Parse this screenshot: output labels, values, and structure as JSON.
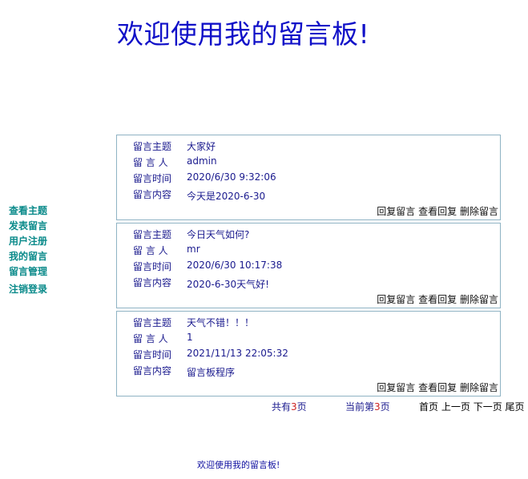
{
  "header": {
    "title": "欢迎使用我的留言板!"
  },
  "sidebar": {
    "items": [
      {
        "label": "查看主题"
      },
      {
        "label": "发表留言"
      },
      {
        "label": "用户注册"
      },
      {
        "label": "我的留言"
      },
      {
        "label": "留言管理"
      },
      {
        "label": "注销登录"
      }
    ]
  },
  "labels": {
    "subject": "留言主题",
    "author": "留 言 人",
    "time": "留言时间",
    "content": "留言内容"
  },
  "actions": {
    "reply": "回复留言",
    "view_replies": "查看回复",
    "delete": "删除留言"
  },
  "messages": [
    {
      "subject": "大家好",
      "author": "admin",
      "time": "2020/6/30 9:32:06",
      "content": "今天是2020-6-30"
    },
    {
      "subject": "今日天气如何?",
      "author": "mr",
      "time": "2020/6/30 10:17:38",
      "content": "2020-6-30天气好!"
    },
    {
      "subject": "天气不错！！！",
      "author": "1",
      "time": "2021/11/13 22:05:32",
      "content": "留言板程序"
    }
  ],
  "pager": {
    "total_prefix": "共有",
    "total_pages": "3",
    "total_suffix": "页",
    "current_prefix": "当前第",
    "current_page": "3",
    "current_suffix": "页",
    "first": "首页",
    "prev": "上一页",
    "next": "下一页",
    "last": "尾页"
  },
  "footer": {
    "text": "欢迎使用我的留言板!"
  }
}
